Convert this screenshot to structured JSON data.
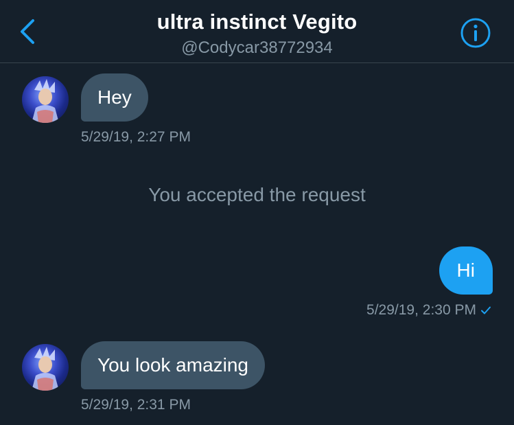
{
  "header": {
    "title": "ultra instinct Vegito",
    "handle": "@Codycar38772934",
    "back_icon": "chevron-left-icon",
    "info_icon": "info-circle-icon"
  },
  "colors": {
    "background": "#15202b",
    "accent": "#1da1f2",
    "received_bubble": "#3d5466",
    "secondary_text": "#8899a6"
  },
  "messages": [
    {
      "direction": "received",
      "text": "Hey",
      "timestamp": "5/29/19, 2:27 PM"
    },
    {
      "direction": "sent",
      "text": "Hi",
      "timestamp": "5/29/19, 2:30 PM",
      "status_icon": "checkmark-icon"
    },
    {
      "direction": "received",
      "text": "You look amazing",
      "timestamp": "5/29/19, 2:31 PM"
    }
  ],
  "system_notice": "You accepted the request"
}
